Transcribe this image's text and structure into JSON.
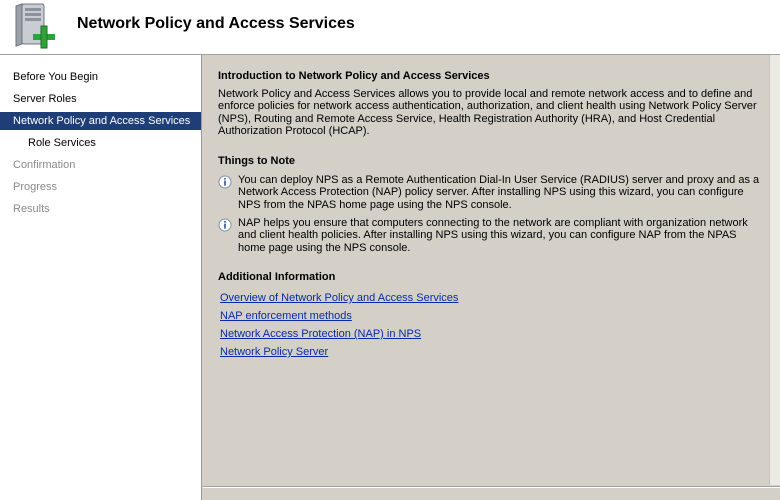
{
  "header": {
    "title": "Network Policy and Access Services",
    "icon": "server-add-icon"
  },
  "sidebar": {
    "items": [
      {
        "label": "Before You Begin",
        "state": "normal"
      },
      {
        "label": "Server Roles",
        "state": "normal"
      },
      {
        "label": "Network Policy and Access Services",
        "state": "active"
      },
      {
        "label": "Role Services",
        "state": "sub"
      },
      {
        "label": "Confirmation",
        "state": "disabled"
      },
      {
        "label": "Progress",
        "state": "disabled"
      },
      {
        "label": "Results",
        "state": "disabled"
      }
    ]
  },
  "content": {
    "intro_heading": "Introduction to Network Policy and Access Services",
    "intro_text": "Network Policy and Access Services allows you to provide local and remote network access and to define and enforce policies for network access authentication, authorization, and client health using Network Policy Server (NPS), Routing and Remote Access Service, Health Registration Authority (HRA), and Host Credential Authorization Protocol (HCAP).",
    "notes_heading": "Things to Note",
    "notes": [
      "You can deploy NPS as a Remote Authentication Dial-In User Service (RADIUS) server and proxy and as a Network Access Protection (NAP) policy server. After installing NPS using this wizard, you can configure NPS from the NPAS home page using the NPS console.",
      "NAP helps you ensure that computers connecting to the network are compliant with organization network and client health policies. After installing NPS using this wizard, you can configure NAP from the NPAS home page using the NPS console."
    ],
    "additional_heading": "Additional Information",
    "links": [
      "Overview of Network Policy and Access Services",
      "NAP enforcement methods",
      "Network Access Protection (NAP) in NPS",
      "Network Policy Server"
    ]
  },
  "colors": {
    "active_nav": "#1f3e78",
    "link": "#0a2aa8",
    "disabled_text": "#8a8a8a"
  }
}
